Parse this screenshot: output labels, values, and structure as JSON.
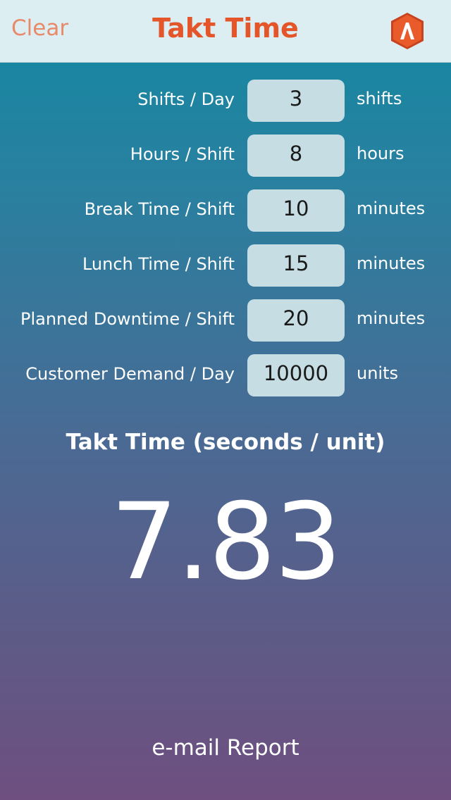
{
  "header": {
    "clear_label": "Clear",
    "title": "Takt Time",
    "logo_icon": "app-logo-icon"
  },
  "rows": [
    {
      "label": "Shifts / Day",
      "value": "3",
      "unit": "shifts"
    },
    {
      "label": "Hours / Shift",
      "value": "8",
      "unit": "hours"
    },
    {
      "label": "Break Time / Shift",
      "value": "10",
      "unit": "minutes"
    },
    {
      "label": "Lunch Time / Shift",
      "value": "15",
      "unit": "minutes"
    },
    {
      "label": "Planned Downtime / Shift",
      "value": "20",
      "unit": "minutes"
    },
    {
      "label": "Customer Demand / Day",
      "value": "10000",
      "unit": "units"
    }
  ],
  "result": {
    "label": "Takt Time (seconds / unit)",
    "value": "7.83"
  },
  "footer": {
    "email_label": "e-mail Report"
  },
  "colors": {
    "header_bg": "#dceef1",
    "title": "#e4552a",
    "clear": "#e88a6a",
    "input_bg": "#c6dde3",
    "logo": "#e4552a"
  }
}
